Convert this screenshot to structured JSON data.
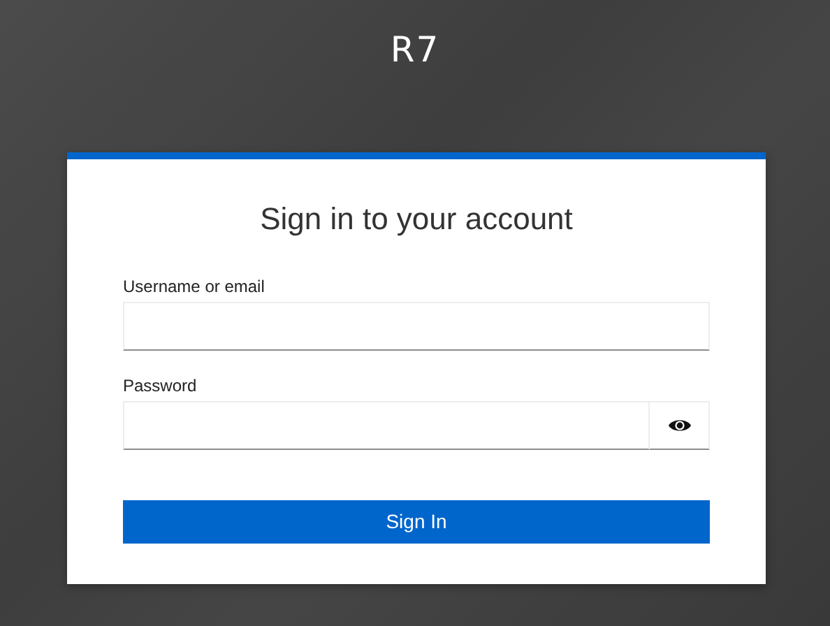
{
  "brand": "R7",
  "form": {
    "title": "Sign in to your account",
    "fields": [
      {
        "label": "Username or email",
        "kind": "text"
      },
      {
        "label": "Password",
        "kind": "password"
      }
    ],
    "submit": "Sign In"
  }
}
